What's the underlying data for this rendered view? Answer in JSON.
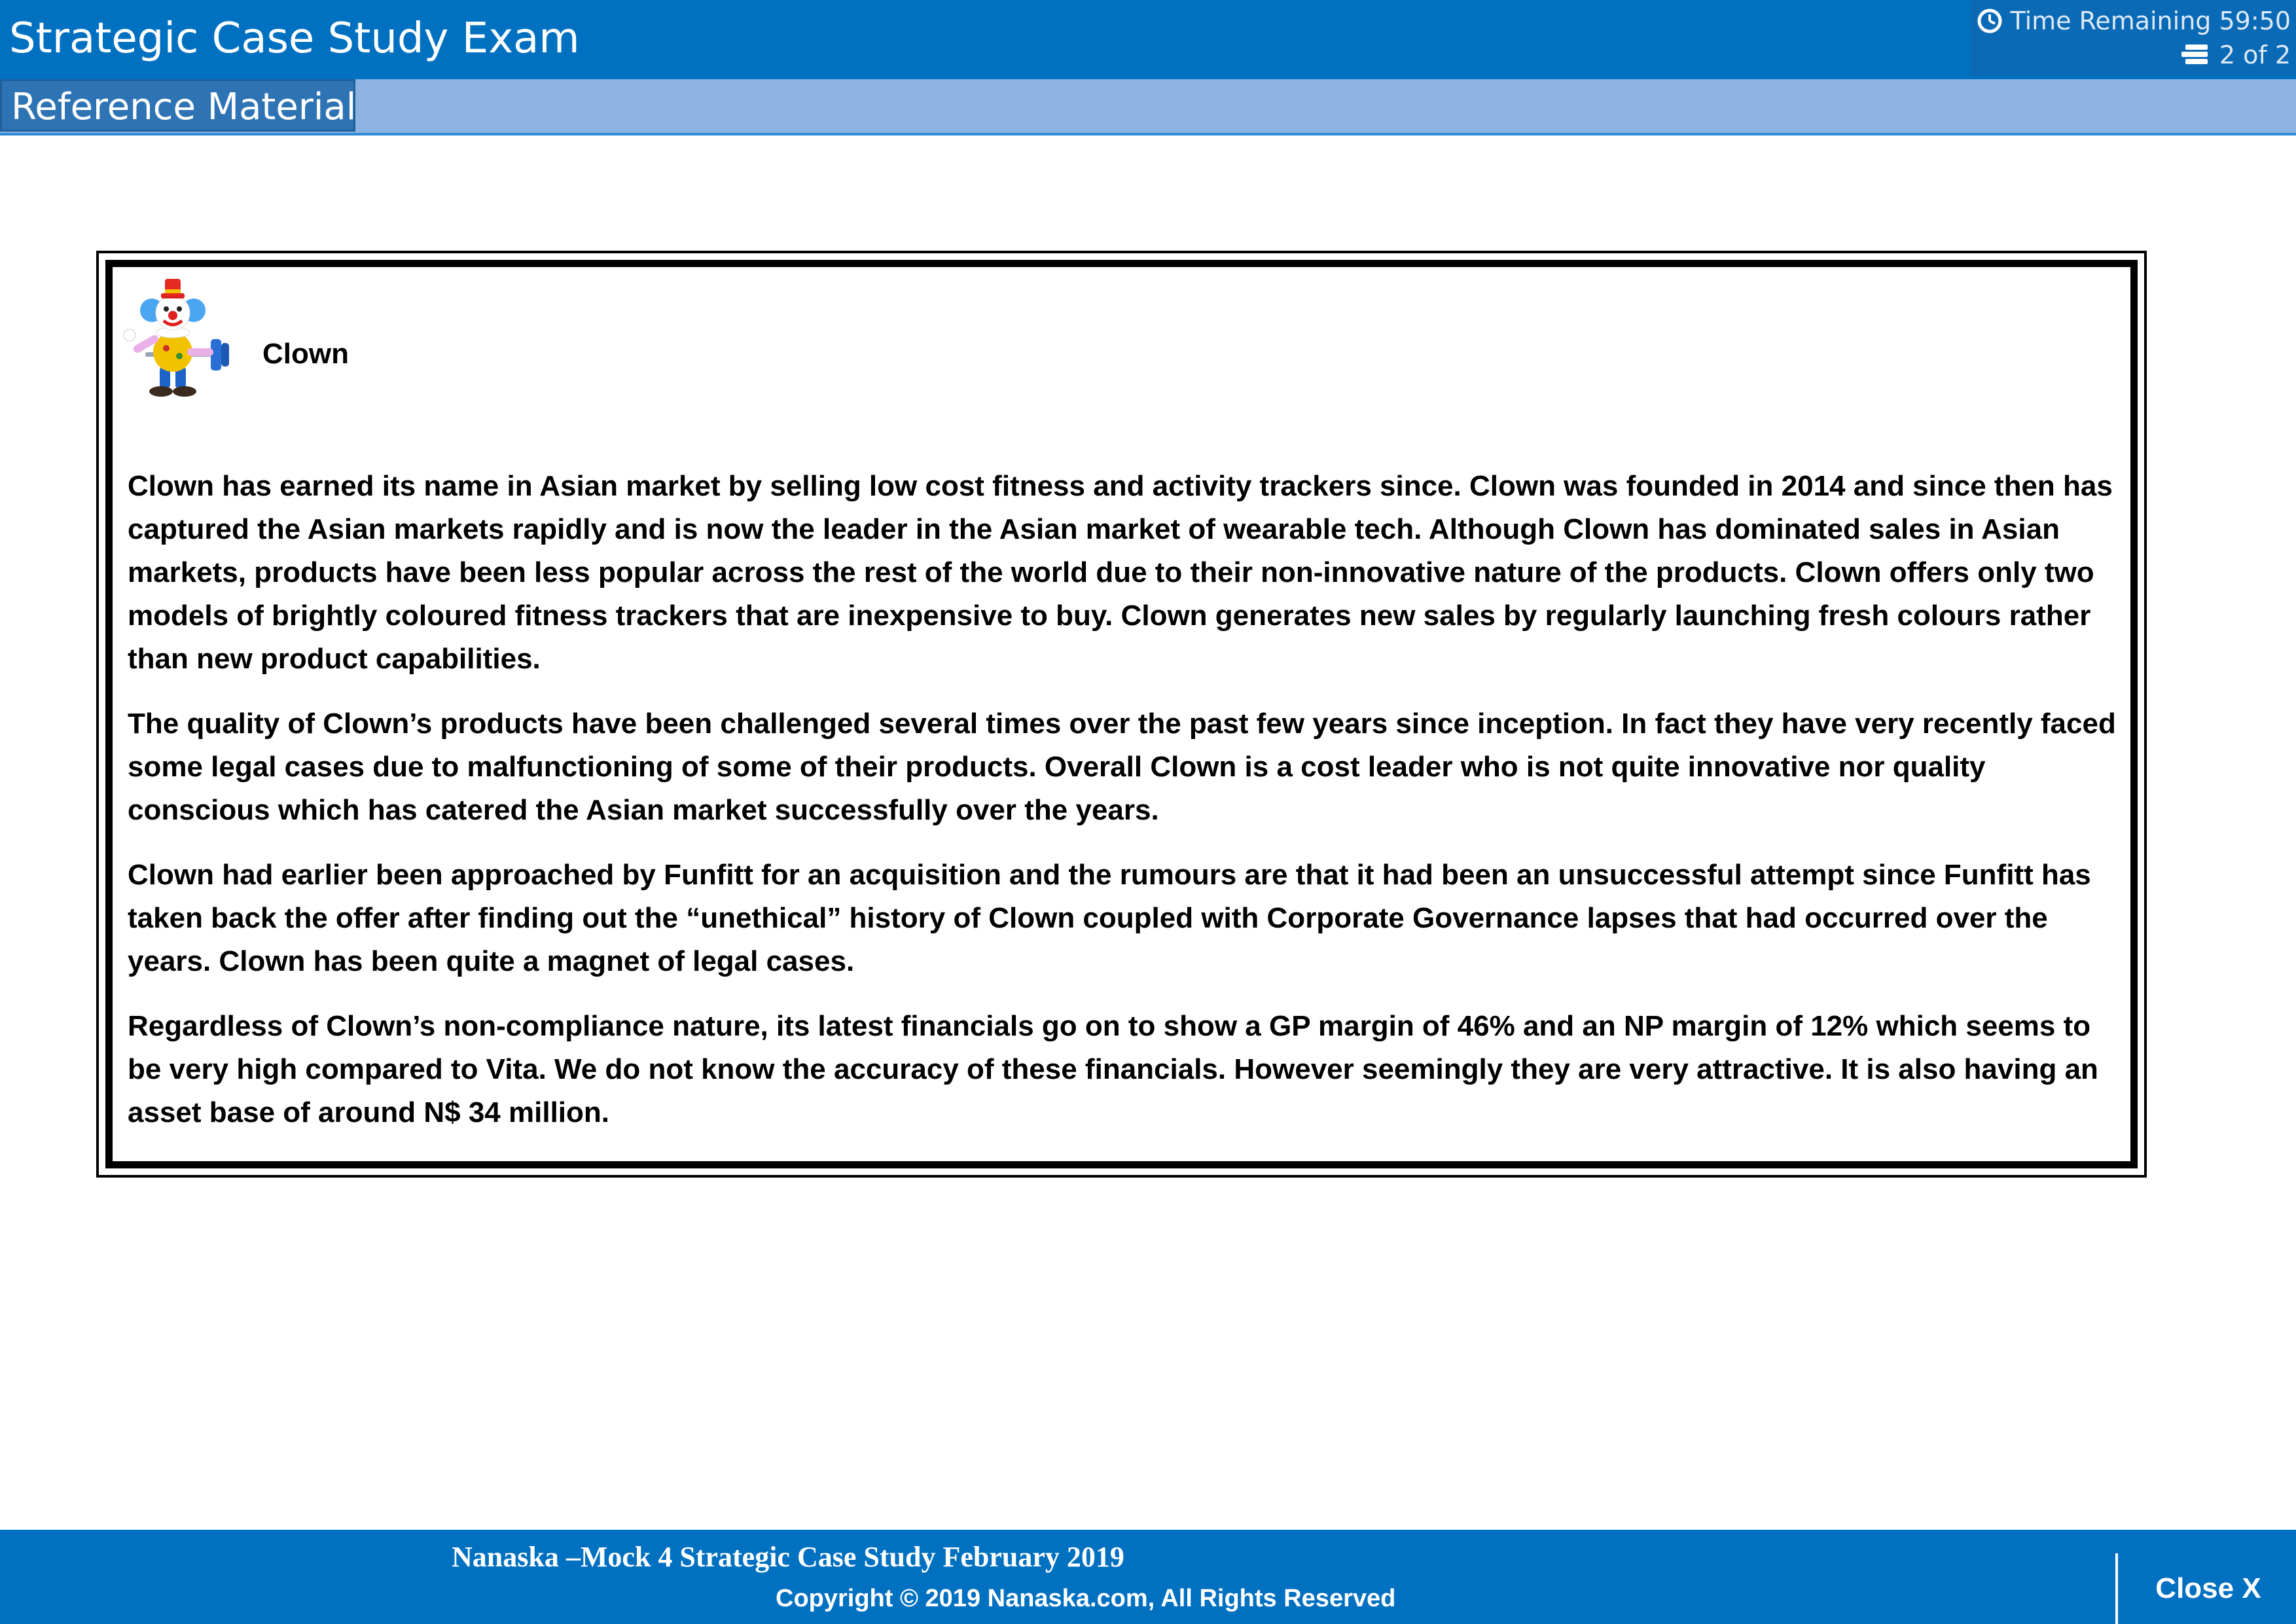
{
  "header": {
    "title": "Strategic Case Study Exam",
    "time_remaining": "Time Remaining 59:50",
    "page_indicator": "2 of 2",
    "timer_icon": "clock-icon",
    "page_icon": "pages-icon"
  },
  "section": {
    "label": "Reference Material"
  },
  "content": {
    "company_name": "Clown",
    "mascot_icon": "clown-mascot",
    "paragraphs": [
      "Clown has earned its name in Asian market by selling low cost fitness and activity trackers since. Clown was founded in 2014 and since then has captured the Asian markets rapidly and is now the leader in the Asian market of wearable tech.  Although Clown has dominated sales in Asian markets, products have been less popular across the rest of the world due to their non-innovative nature of the products. Clown offers only two models of brightly coloured fitness trackers that are inexpensive to buy. Clown generates new sales by regularly launching fresh colours rather than new product capabilities.",
      "The quality of Clown’s products have been challenged several times over the past few years since inception. In fact they have very recently faced some legal cases due to malfunctioning of some of their products. Overall Clown is a cost leader who is not quite innovative nor quality conscious which has catered the Asian market successfully over the years.",
      "Clown had earlier been approached by Funfitt for an acquisition and the rumours are that it had been an unsuccessful attempt since Funfitt has taken back the offer after finding out the “unethical” history of Clown coupled with Corporate Governance lapses that had occurred over the years. Clown has been quite a magnet of legal cases.",
      "Regardless of Clown’s non-compliance nature, its latest financials go on to show a GP margin of 46% and an NP margin of 12% which seems to be very high compared to Vita. We do not know the accuracy of these financials. However seemingly they are very attractive. It is also having an asset base of around N$ 34 million."
    ]
  },
  "footer": {
    "title": "Nanaska –Mock 4 Strategic Case Study February 2019",
    "copyright": "Copyright © 2019 Nanaska.com, All Rights Reserved",
    "close_label": "Close X"
  },
  "colors": {
    "header_bg": "#0070c0",
    "subheader_bg": "#8db3e2",
    "section_tab_bg": "#2e74b5",
    "footer_bg": "#0070c0"
  }
}
